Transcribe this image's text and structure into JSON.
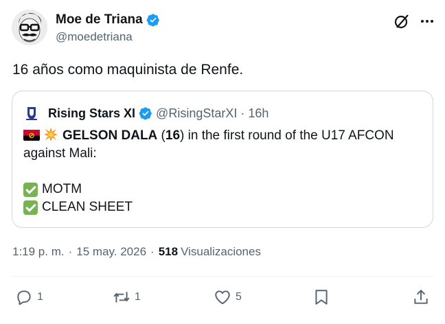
{
  "author": {
    "display_name": "Moe de Triana",
    "handle": "@moedetriana"
  },
  "tweet": {
    "text": "16 años como maquinista de Renfe."
  },
  "quote": {
    "display_name": "Rising Stars XI",
    "handle": "@RisingStarXI",
    "separator": "·",
    "time": "16h",
    "line1_bold": "GELSON DALA",
    "line1_paren_open": " (",
    "line1_number": "16",
    "line1_rest": ") in the first round of the U17 AFCON",
    "line2": "against Mali:",
    "check1": "MOTM",
    "check2": "CLEAN SHEET"
  },
  "meta": {
    "time": "1:19 p. m.",
    "sep1": "·",
    "date": "15 may. 2026",
    "sep2": "·",
    "views_count": "518",
    "views_label": "Visualizaciones"
  },
  "actions": {
    "reply_count": "1",
    "repost_count": "1",
    "like_count": "5"
  },
  "colors": {
    "verified": "#1d9bf0",
    "secondary_text": "#536471",
    "check": "#77b255"
  }
}
